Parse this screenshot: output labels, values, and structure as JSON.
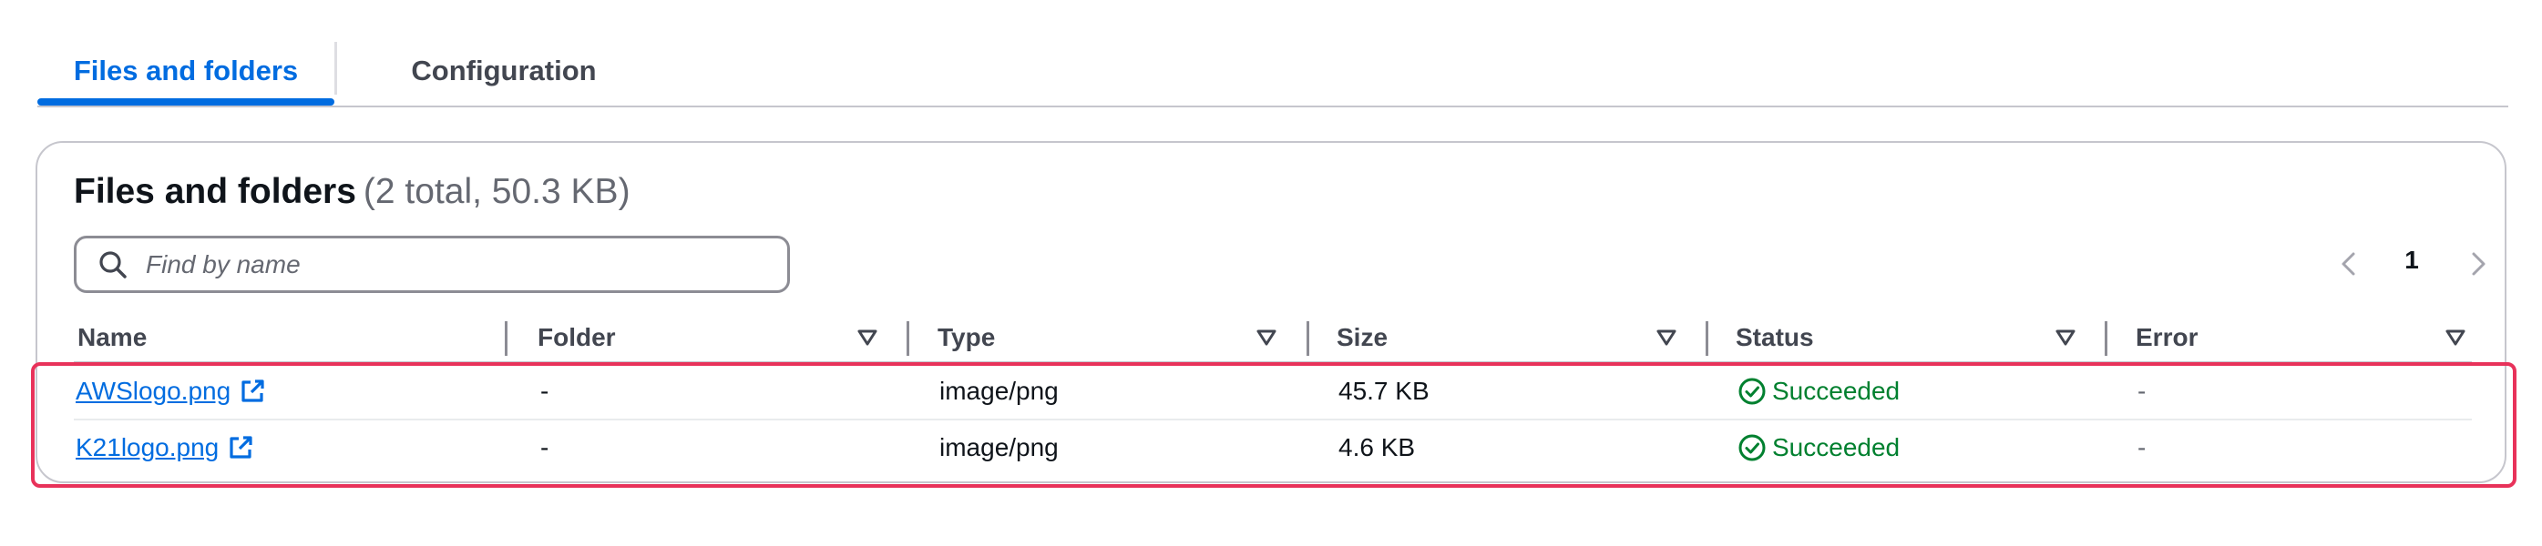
{
  "tabs": [
    {
      "label": "Files and folders",
      "active": true
    },
    {
      "label": "Configuration",
      "active": false
    }
  ],
  "header": {
    "title": "Files and folders",
    "count": "(2 total, 50.3 KB)"
  },
  "search": {
    "placeholder": "Find by name",
    "value": ""
  },
  "pagination": {
    "current_page": "1"
  },
  "table": {
    "columns": [
      "Name",
      "Folder",
      "Type",
      "Size",
      "Status",
      "Error"
    ],
    "rows": [
      {
        "name": "AWSlogo.png",
        "folder": "-",
        "type": "image/png",
        "size": "45.7 KB",
        "status": "Succeeded",
        "error": "-"
      },
      {
        "name": "K21logo.png",
        "folder": "-",
        "type": "image/png",
        "size": "4.6 KB",
        "status": "Succeeded",
        "error": "-"
      }
    ]
  },
  "colors": {
    "accent": "#006ce0",
    "success": "#00802f",
    "highlight": "#e8325a",
    "text": "#0f141a",
    "muted": "#656871"
  },
  "icons": [
    "search-icon",
    "chevron-left-icon",
    "chevron-right-icon",
    "sort-caret-icon",
    "external-link-icon",
    "status-success-icon"
  ]
}
